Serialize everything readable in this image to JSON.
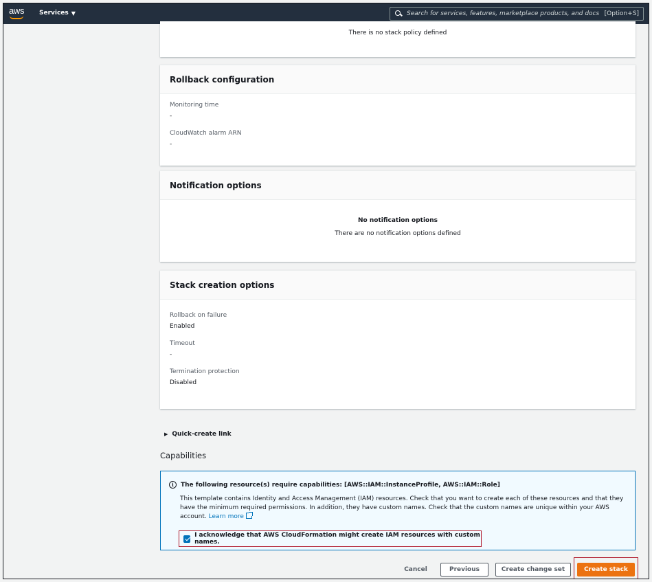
{
  "nav": {
    "logo": "aws",
    "services_label": "Services",
    "search_placeholder": "Search for services, features, marketplace products, and docs",
    "search_shortcut": "[Option+S]"
  },
  "stack_policy": {
    "message": "There is no stack policy defined"
  },
  "rollback": {
    "title": "Rollback configuration",
    "monitoring_time_label": "Monitoring time",
    "monitoring_time_value": "-",
    "alarm_label": "CloudWatch alarm ARN",
    "alarm_value": "-"
  },
  "notifications": {
    "title": "Notification options",
    "empty_title": "No notification options",
    "empty_message": "There are no notification options defined"
  },
  "stack_creation": {
    "title": "Stack creation options",
    "rollback_label": "Rollback on failure",
    "rollback_value": "Enabled",
    "timeout_label": "Timeout",
    "timeout_value": "-",
    "termination_label": "Termination protection",
    "termination_value": "Disabled"
  },
  "quick_create": {
    "label": "Quick-create link"
  },
  "capabilities": {
    "title": "Capabilities",
    "alert_heading": "The following resource(s) require capabilities: [AWS::IAM::InstanceProfile, AWS::IAM::Role]",
    "alert_body": "This template contains Identity and Access Management (IAM) resources. Check that you want to create each of these resources and that they have the minimum required permissions. In addition, they have custom names. Check that the custom names are unique within your AWS account.",
    "learn_more": "Learn more",
    "ack_label": "I acknowledge that AWS CloudFormation might create IAM resources with custom names."
  },
  "actions": {
    "cancel": "Cancel",
    "previous": "Previous",
    "create_change_set": "Create change set",
    "create_stack": "Create stack"
  },
  "colors": {
    "nav_bg": "#232f3e",
    "primary": "#ec7211",
    "link": "#0073bb",
    "highlight": "#b0182b"
  }
}
